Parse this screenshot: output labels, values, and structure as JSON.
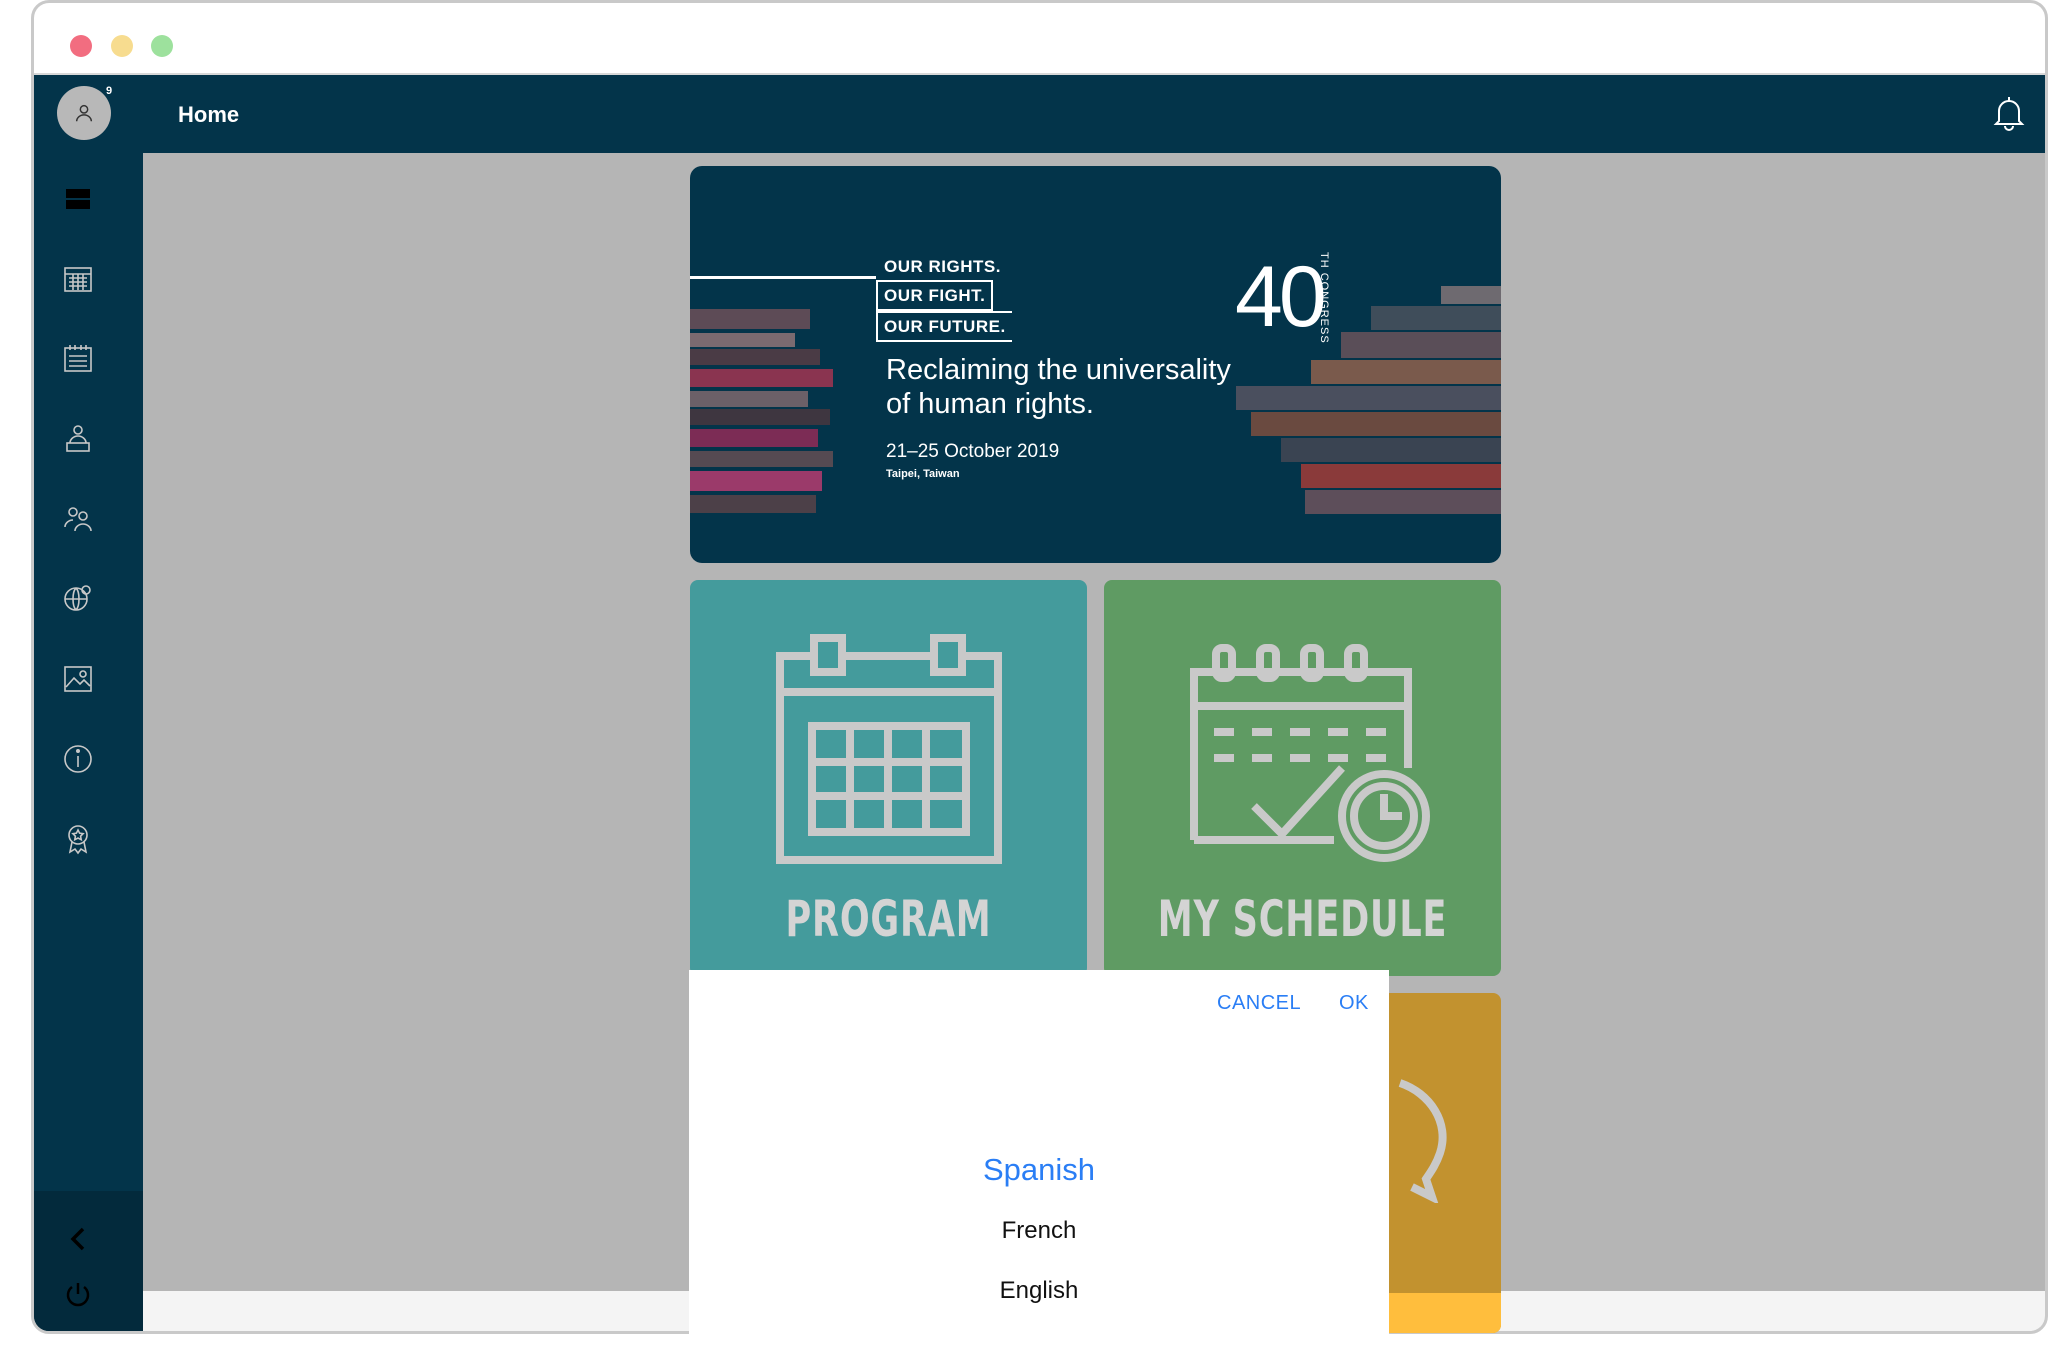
{
  "header": {
    "title": "Home"
  },
  "avatar": {
    "badge": "9"
  },
  "sidebar": {
    "icons": [
      "list-icon",
      "calendar-icon",
      "schedule-icon",
      "speaker-icon",
      "people-icon",
      "globe-people-icon",
      "gallery-icon",
      "info-icon",
      "award-icon"
    ],
    "collapse_icon": "chevron-left-icon",
    "logout_icon": "power-icon"
  },
  "banner": {
    "slogan": [
      "OUR RIGHTS.",
      "OUR FIGHT.",
      "OUR FUTURE."
    ],
    "tagline_1": "Reclaiming the universality",
    "tagline_2": "of human rights.",
    "dates": "21–25 October 2019",
    "place": "Taipei, Taiwan",
    "number": "40",
    "congress": "TH CONGRESS"
  },
  "tiles": {
    "program": "PROGRAM",
    "schedule": "MY SCHEDULE"
  },
  "picker": {
    "cancel": "CANCEL",
    "ok": "OK",
    "options": [
      "Spanish",
      "French",
      "English"
    ],
    "selected": "Spanish"
  },
  "colors": {
    "navy": "#03344a",
    "teal": "#449b9c",
    "green": "#5f9b63",
    "gold": "#c2922f",
    "accent_blue": "#2a7ef5"
  }
}
